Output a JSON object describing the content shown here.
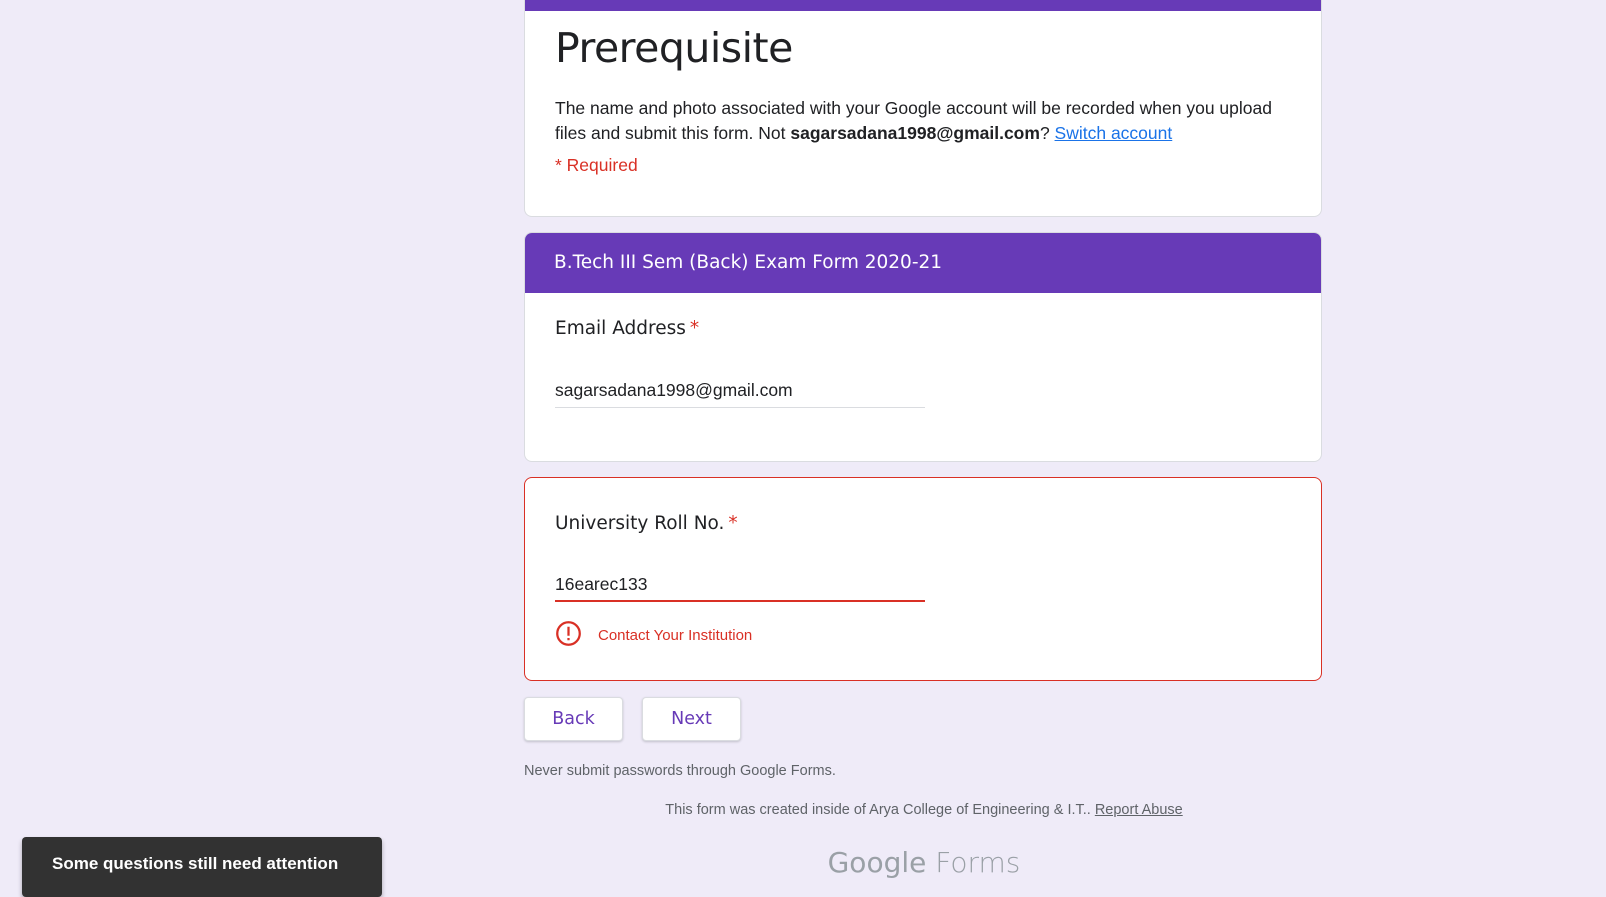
{
  "header": {
    "title": "Prerequisite",
    "description_part1": "The name and photo associated with your Google account will be recorded when you upload files and submit this form. Not ",
    "account_email": "sagarsadana1998@gmail.com",
    "description_part2": "? ",
    "switch_account": "Switch account",
    "required_note": "* Required"
  },
  "section": {
    "title": "B.Tech III Sem (Back) Exam Form 2020-21"
  },
  "questions": {
    "email": {
      "label": "Email Address",
      "required_mark": "*",
      "value": "sagarsadana1998@gmail.com"
    },
    "roll": {
      "label": "University Roll No.",
      "required_mark": "*",
      "value": "16earec133",
      "error": "Contact Your Institution"
    }
  },
  "buttons": {
    "back": "Back",
    "next": "Next"
  },
  "footer": {
    "warning": "Never submit passwords through Google Forms.",
    "created_text": "This form was created inside of Arya College of Engineering & I.T..",
    "report_abuse": "Report Abuse",
    "logo_google": "Google",
    "logo_forms": "Forms"
  },
  "toast": {
    "message": "Some questions still need attention"
  },
  "colors": {
    "accent": "#673ab7",
    "error": "#d93025",
    "background": "#efebf8"
  }
}
